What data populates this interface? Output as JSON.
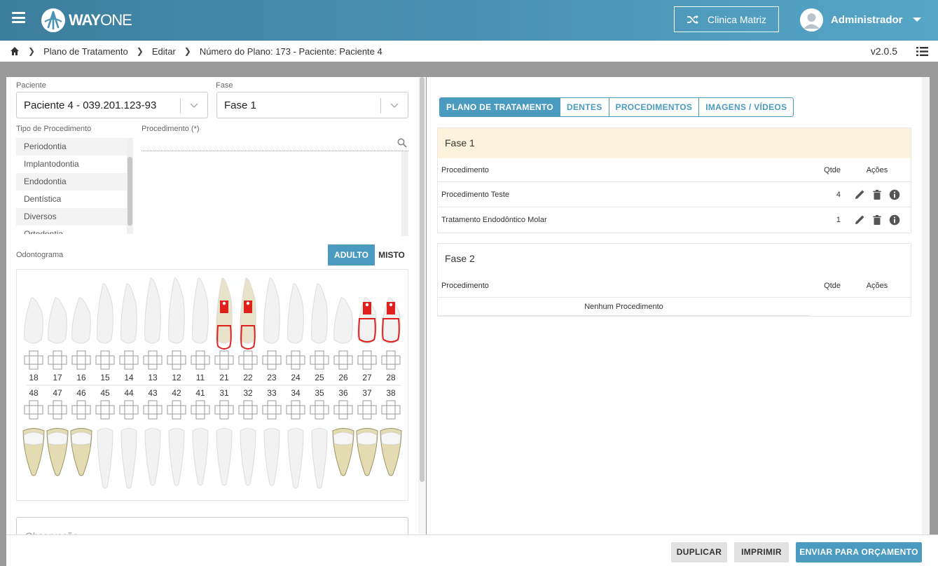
{
  "header": {
    "logo_text_bold": "WAY",
    "logo_text_thin": "ONE",
    "clinic_label": "Clinica Matriz",
    "user_name": "Administrador"
  },
  "breadcrumb": {
    "items": [
      "Plano de Tratamento",
      "Editar",
      "Número do Plano: 173 - Paciente: Paciente 4"
    ],
    "version": "v2.0.5"
  },
  "form": {
    "paciente_label": "Paciente",
    "paciente_value": "Paciente 4 - 039.201.123-93",
    "fase_label": "Fase",
    "fase_value": "Fase 1",
    "tipo_label": "Tipo de Procedimento",
    "tipo_items": [
      "Periodontia",
      "Implantodontia",
      "Endodontia",
      "Dentística",
      "Diversos",
      "Ortodontia"
    ],
    "procedimento_label": "Procedimento (*)",
    "odontograma_label": "Odontograma",
    "toggle_adulto": "ADULTO",
    "toggle_misto": "MISTO",
    "observacao_placeholder": "Observação"
  },
  "odontogram": {
    "upper_numbers": [
      "18",
      "17",
      "16",
      "15",
      "14",
      "13",
      "12",
      "11",
      "21",
      "22",
      "23",
      "24",
      "25",
      "26",
      "27",
      "28"
    ],
    "lower_numbers": [
      "48",
      "47",
      "46",
      "45",
      "44",
      "43",
      "42",
      "41",
      "31",
      "32",
      "33",
      "34",
      "35",
      "36",
      "37",
      "38"
    ],
    "marked_upper": [
      "21",
      "22",
      "27",
      "28"
    ],
    "colors": {
      "mark": "#e0201c",
      "tooth": "#f2f2f2",
      "molar_lower": "#e3dcb2"
    }
  },
  "tabs": [
    "PLANO DE TRATAMENTO",
    "DENTES",
    "PROCEDIMENTOS",
    "IMAGENS / VÍDEOS"
  ],
  "phases": [
    {
      "title": "Fase 1",
      "col_proc": "Procedimento",
      "col_qtd": "Qtde",
      "col_acoes": "Ações",
      "rows": [
        {
          "name": "Procedimento Teste",
          "qtd": "4"
        },
        {
          "name": "Tratamento Endodôntico Molar",
          "qtd": "1"
        }
      ]
    },
    {
      "title": "Fase 2",
      "col_proc": "Procedimento",
      "col_qtd": "Qtde",
      "col_acoes": "Ações",
      "empty": "Nenhum Procedimento"
    }
  ],
  "footer": {
    "duplicar": "DUPLICAR",
    "imprimir": "IMPRIMIR",
    "enviar": "ENVIAR PARA ORÇAMENTO"
  },
  "theme": {
    "primary": "#4a9bbf",
    "header_from": "#3d7e9c",
    "header_to": "#56a6c6"
  }
}
